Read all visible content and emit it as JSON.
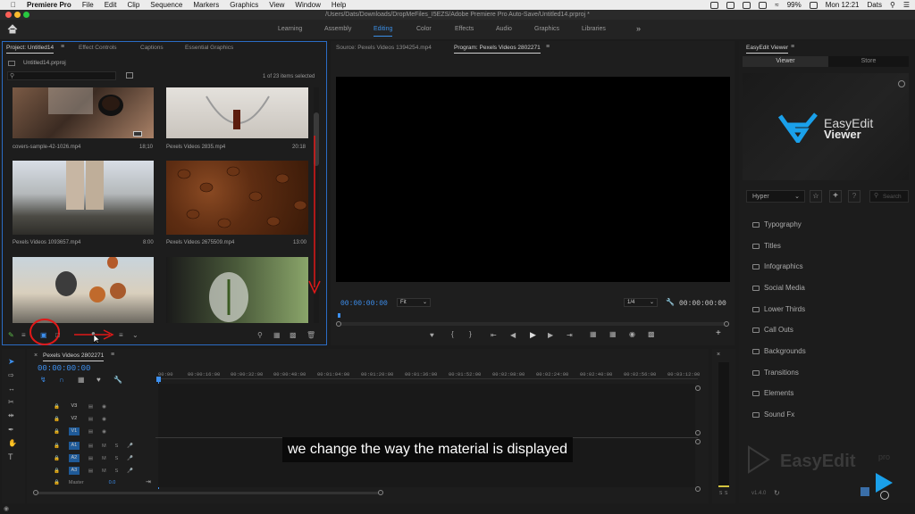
{
  "menubar": {
    "app_name": "Premiere Pro",
    "menus": [
      "File",
      "Edit",
      "Clip",
      "Sequence",
      "Markers",
      "Graphics",
      "View",
      "Window",
      "Help"
    ],
    "battery": "99%",
    "clock": "Mon 12:21",
    "user": "Dats"
  },
  "window": {
    "title": "/Users/Dats/Downloads/DropMeFiles_I5EZS/Adobe Premiere Pro Auto-Save/Untitled14.prproj *"
  },
  "workspaces": {
    "tabs": [
      "Learning",
      "Assembly",
      "Editing",
      "Color",
      "Effects",
      "Audio",
      "Graphics",
      "Libraries"
    ],
    "active": "Editing"
  },
  "project_panel": {
    "tabs": [
      "Project: Untitled14",
      "Effect Controls",
      "Captions",
      "Essential Graphics"
    ],
    "file": "Untitled14.prproj",
    "selection_status": "1 of 23 items selected",
    "items": [
      {
        "name": "covers-sample-42-1026.mp4",
        "duration": "18;10"
      },
      {
        "name": "Pexels Videos 2835.mp4",
        "duration": "20:18"
      },
      {
        "name": "Pexels Videos 1093657.mp4",
        "duration": "8:00"
      },
      {
        "name": "Pexels Videos 2675509.mp4",
        "duration": "13:00"
      }
    ]
  },
  "source_monitor": {
    "title": "Source: Pexels Videos 1394254.mp4"
  },
  "program_monitor": {
    "title": "Program: Pexels Videos 2802271",
    "timecode": "00:00:00:00",
    "fit": "Fit",
    "resolution": "1/4",
    "duration": "00:00:00:00"
  },
  "easyedit": {
    "title": "EasyEdit Viewer",
    "tabs": [
      "Viewer",
      "Store"
    ],
    "logo_line1": "EasyEdit",
    "logo_line2": "Viewer",
    "filter": "Hyper",
    "search_placeholder": "Search",
    "categories": [
      "Typography",
      "Titles",
      "Infographics",
      "Social Media",
      "Lower Thirds",
      "Call Outs",
      "Backgrounds",
      "Transitions",
      "Elements",
      "Sound Fx"
    ],
    "version": "v1.4.0",
    "watermark": "EasyEdit",
    "watermark_suffix": "pro"
  },
  "timeline": {
    "sequence_name": "Pexels Videos 2802271",
    "timecode": "00:00:00:00",
    "ruler": [
      "00:00",
      "00:00:16:00",
      "00:00:32:00",
      "00:00:48:00",
      "00:01:04:00",
      "00:01:20:00",
      "00:01:36:00",
      "00:01:52:00",
      "00:02:08:00",
      "00:02:24:00",
      "00:02:40:00",
      "00:02:56:00",
      "00:03:12:00"
    ],
    "video_tracks": [
      "V3",
      "V2",
      "V1"
    ],
    "audio_tracks": [
      "A1",
      "A2",
      "A3"
    ],
    "master_label": "Master",
    "master_value": "0.0",
    "meter_labels": [
      "S",
      "S"
    ]
  },
  "caption": "we change the way the material is displayed",
  "colors": {
    "accent": "#3d90f0",
    "annotation": "#e01818"
  }
}
